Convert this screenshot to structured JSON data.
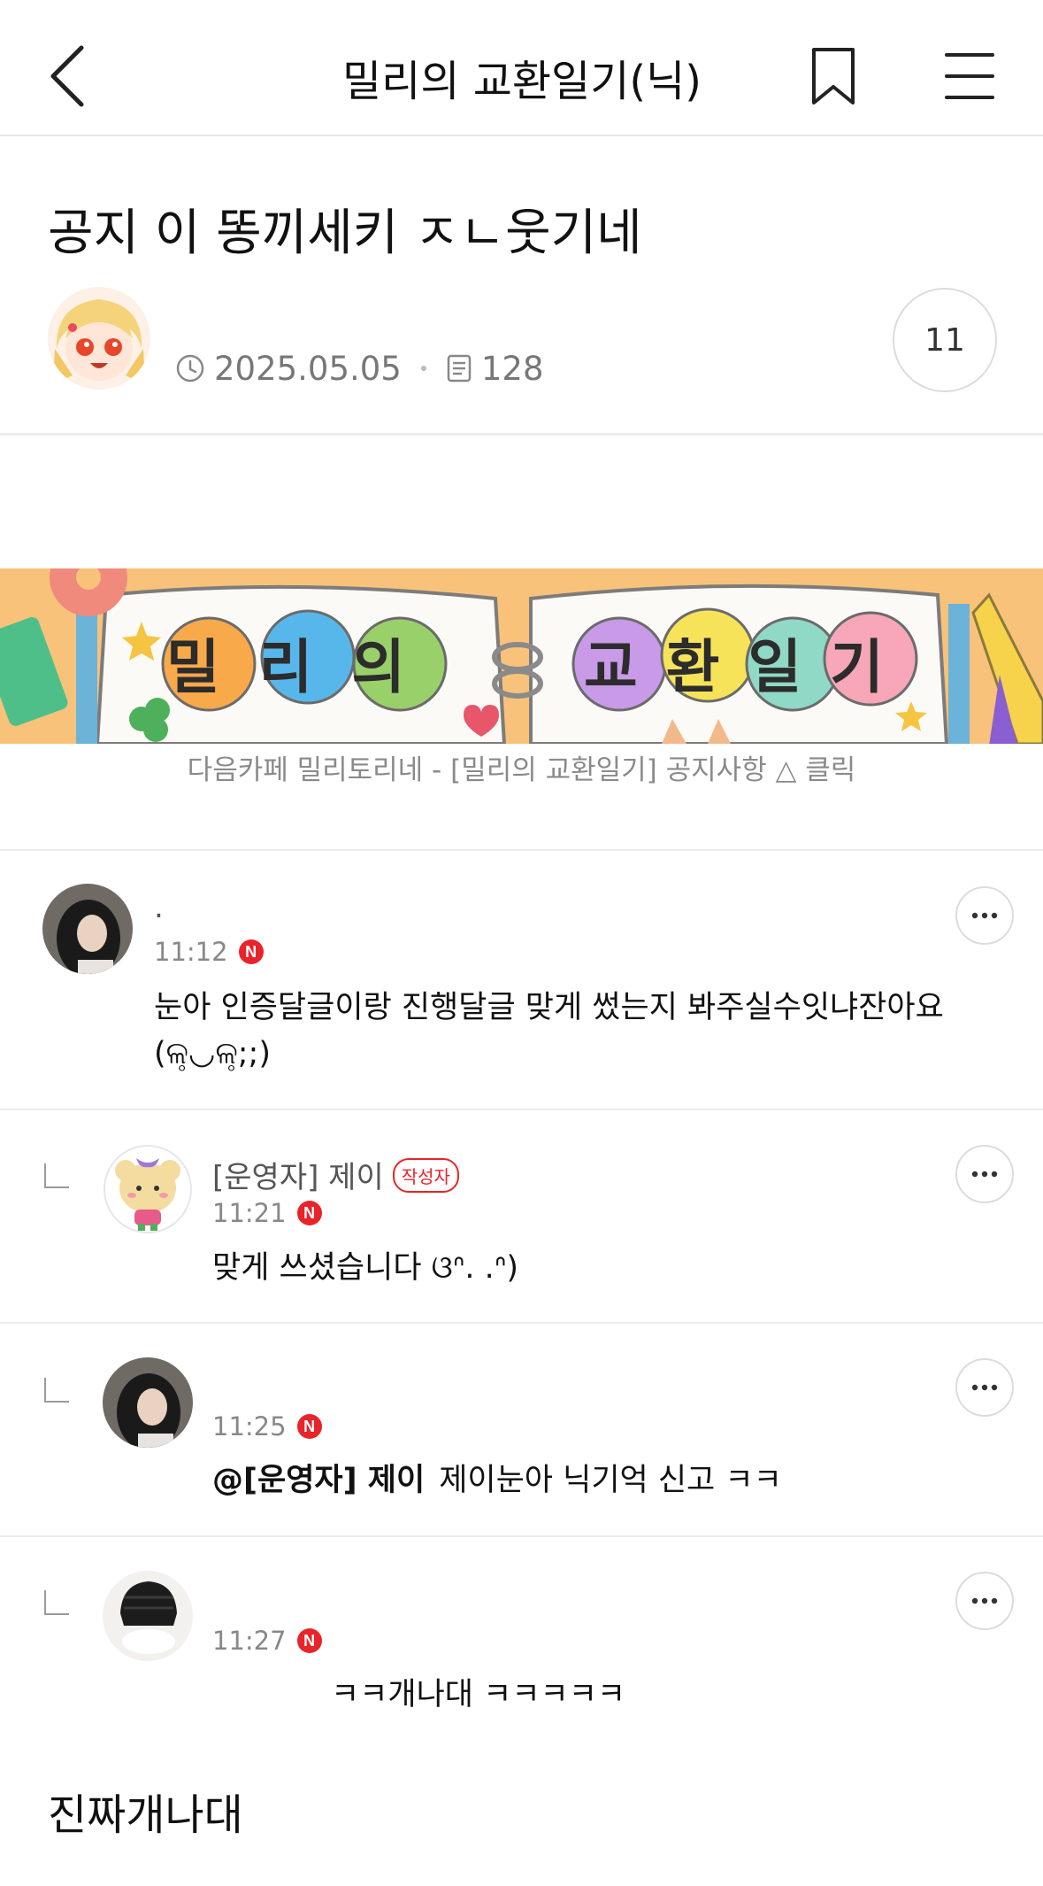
{
  "header": {
    "title": "밀리의 교환일기(닉)",
    "back_icon": "chevron-left-icon",
    "bookmark_icon": "bookmark-icon",
    "menu_icon": "hamburger-menu-icon"
  },
  "post": {
    "title": "공지 이 똥끼세키 ㅈㄴ웃기네",
    "date": "2025.05.05",
    "views": "128",
    "comment_count": "11"
  },
  "banner": {
    "title_left": "밀리의",
    "title_right": "교환일기",
    "caption": "다음카페 밀리토리네 - [밀리의 교환일기] 공지사항 △ 클릭"
  },
  "comments": [
    {
      "name": ".",
      "time": "11:12",
      "text_line1": "눈아 인증달글이랑 진행달글 맞게 썼는지 봐주실수잇냐잔아요",
      "text_line2": "(ଳ̥◡ଳ̥;;)"
    },
    {
      "name": "[운영자] 제이",
      "badge": "작성자",
      "time": "11:21",
      "text": "맞게 쓰셨습니다 ଓᐢ. .ᐢ)"
    },
    {
      "time": "11:25",
      "mention": "@[운영자] 제이",
      "text": "제이눈아 닉기억 신고 ㅋㅋ"
    },
    {
      "time": "11:27",
      "text": "ㅋㅋ개나대 ㅋㅋㅋㅋㅋ"
    }
  ],
  "footer_text": "진짜개나대",
  "colors": {
    "accent_red": "#e8242a",
    "banner_bg": "#f9c27a"
  }
}
